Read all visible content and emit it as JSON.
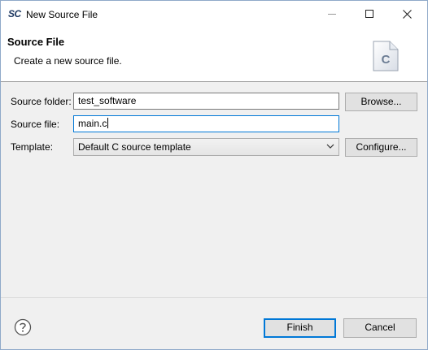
{
  "window": {
    "app_logo": "SC",
    "title": "New Source File"
  },
  "banner": {
    "title": "Source File",
    "description": "Create a new source file.",
    "icon_letter": "C"
  },
  "form": {
    "source_folder": {
      "label": "Source folder:",
      "value": "test_software"
    },
    "source_file": {
      "label": "Source file:",
      "value": "main.c"
    },
    "template": {
      "label": "Template:",
      "selected": "Default C source template"
    }
  },
  "buttons": {
    "browse": "Browse...",
    "configure": "Configure...",
    "finish": "Finish",
    "cancel": "Cancel"
  },
  "colors": {
    "focus_border": "#0078d7",
    "button_face": "#e1e1e1"
  }
}
